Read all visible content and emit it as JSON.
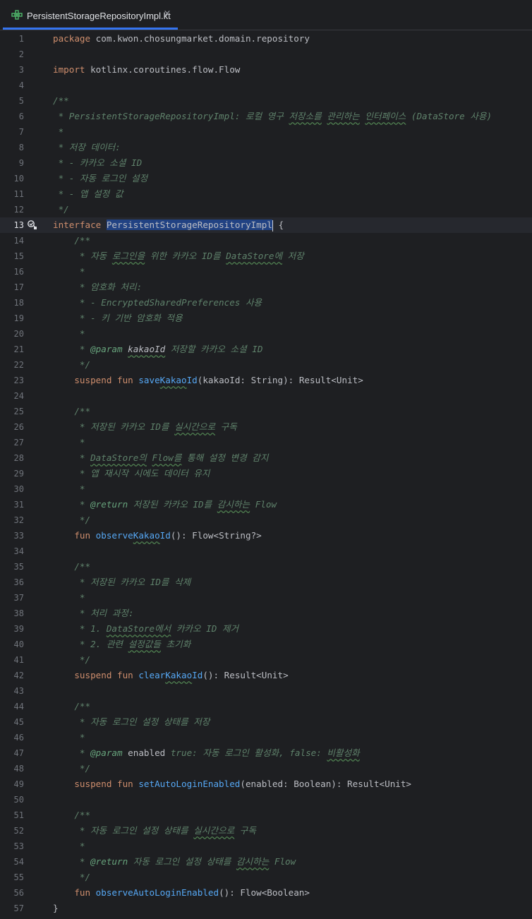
{
  "tab": {
    "title": "PersistentStorageRepositoryImpl.kt",
    "close_glyph": "×",
    "icon": "kotlin-interface-icon"
  },
  "lines": {
    "l1": {
      "n": "1",
      "a": "package",
      "b": " com.kwon.chosungmarket.domain.repository"
    },
    "l2": {
      "n": "2"
    },
    "l3": {
      "n": "3",
      "a": "import",
      "b": " kotlinx.coroutines.flow.Flow"
    },
    "l4": {
      "n": "4"
    },
    "l5": {
      "n": "5",
      "a": "/**"
    },
    "l6": {
      "n": "6",
      "a": " * PersistentStorageRepositoryImpl: 로컬 영구 ",
      "b": "저장소를",
      "c": " ",
      "d": "관리하는",
      "e": " ",
      "f": "인터페이스",
      "g": " (DataStore 사용)"
    },
    "l7": {
      "n": "7",
      "a": " *"
    },
    "l8": {
      "n": "8",
      "a": " * 저장 데이터:"
    },
    "l9": {
      "n": "9",
      "a": " * - 카카오 소셜 ID"
    },
    "l10": {
      "n": "10",
      "a": " * - 자동 로그인 설정"
    },
    "l11": {
      "n": "11",
      "a": " * - 앱 설정 값"
    },
    "l12": {
      "n": "12",
      "a": " */"
    },
    "l13": {
      "n": "13",
      "a": "interface",
      "b": " ",
      "c": "PersistentStorageRepositoryImpl",
      "d": " {"
    },
    "l14": {
      "n": "14",
      "a": "    /**"
    },
    "l15": {
      "n": "15",
      "a": "     * 자동 ",
      "b": "로그인을",
      "c": " 위한 카카오 ID를 ",
      "d": "DataStore에",
      "e": " 저장"
    },
    "l16": {
      "n": "16",
      "a": "     *"
    },
    "l17": {
      "n": "17",
      "a": "     * 암호화 처리:"
    },
    "l18": {
      "n": "18",
      "a": "     * - EncryptedSharedPreferences 사용"
    },
    "l19": {
      "n": "19",
      "a": "     * - 키 기반 암호화 적용"
    },
    "l20": {
      "n": "20",
      "a": "     *"
    },
    "l21": {
      "n": "21",
      "a": "     * ",
      "b": "@param",
      "c": " ",
      "d": "kakaoId",
      "e": " 저장할 카카오 소셜 ID"
    },
    "l22": {
      "n": "22",
      "a": "     */"
    },
    "l23": {
      "n": "23",
      "a": "    suspend fun ",
      "b": "save",
      "c": "Kakao",
      "d": "Id",
      "e": "(kakaoId: String): Result<Unit>"
    },
    "l24": {
      "n": "24"
    },
    "l25": {
      "n": "25",
      "a": "    /**"
    },
    "l26": {
      "n": "26",
      "a": "     * 저장된 카카오 ID를 ",
      "b": "실시간으로",
      "c": " 구독"
    },
    "l27": {
      "n": "27",
      "a": "     *"
    },
    "l28": {
      "n": "28",
      "a": "     * ",
      "b": "DataStore의",
      "c": " ",
      "d": "Flow를",
      "e": " 통해 설정 변경 감지"
    },
    "l29": {
      "n": "29",
      "a": "     * 앱 재시작 시에도 데이터 유지"
    },
    "l30": {
      "n": "30",
      "a": "     *"
    },
    "l31": {
      "n": "31",
      "a": "     * ",
      "b": "@return",
      "c": " 저장된 카카오 ID를 ",
      "d": "감시하는",
      "e": " Flow"
    },
    "l32": {
      "n": "32",
      "a": "     */"
    },
    "l33": {
      "n": "33",
      "a": "    fun ",
      "b": "observe",
      "c": "Kakao",
      "d": "Id",
      "e": "(): Flow<String?>"
    },
    "l34": {
      "n": "34"
    },
    "l35": {
      "n": "35",
      "a": "    /**"
    },
    "l36": {
      "n": "36",
      "a": "     * 저장된 카카오 ID를 삭제"
    },
    "l37": {
      "n": "37",
      "a": "     *"
    },
    "l38": {
      "n": "38",
      "a": "     * 처리 과정:"
    },
    "l39": {
      "n": "39",
      "a": "     * 1. ",
      "b": "DataStore에서",
      "c": " 카카오 ID 제거"
    },
    "l40": {
      "n": "40",
      "a": "     * 2. 관련 ",
      "b": "설정값들",
      "c": " 초기화"
    },
    "l41": {
      "n": "41",
      "a": "     */"
    },
    "l42": {
      "n": "42",
      "a": "    suspend fun ",
      "b": "clear",
      "c": "Kakao",
      "d": "Id",
      "e": "(): Result<Unit>"
    },
    "l43": {
      "n": "43"
    },
    "l44": {
      "n": "44",
      "a": "    /**"
    },
    "l45": {
      "n": "45",
      "a": "     * 자동 로그인 설정 상태를 저장"
    },
    "l46": {
      "n": "46",
      "a": "     *"
    },
    "l47": {
      "n": "47",
      "a": "     * ",
      "b": "@param",
      "c": " ",
      "d": "enabled",
      "e": " true: 자동 로그인 활성화, false: ",
      "f": "비활성화"
    },
    "l48": {
      "n": "48",
      "a": "     */"
    },
    "l49": {
      "n": "49",
      "a": "    suspend fun ",
      "b": "setAutoLoginEnabled",
      "c": "(enabled: Boolean): Result<Unit>"
    },
    "l50": {
      "n": "50"
    },
    "l51": {
      "n": "51",
      "a": "    /**"
    },
    "l52": {
      "n": "52",
      "a": "     * 자동 로그인 설정 상태를 ",
      "b": "실시간으로",
      "c": " 구독"
    },
    "l53": {
      "n": "53",
      "a": "     *"
    },
    "l54": {
      "n": "54",
      "a": "     * ",
      "b": "@return",
      "c": " 자동 로그인 설정 상태를 ",
      "d": "감시하는",
      "e": " Flow"
    },
    "l55": {
      "n": "55",
      "a": "     */"
    },
    "l56": {
      "n": "56",
      "a": "    fun ",
      "b": "observeAutoLoginEnabled",
      "c": "(): Flow<Boolean>"
    },
    "l57": {
      "n": "57",
      "a": "}"
    }
  }
}
